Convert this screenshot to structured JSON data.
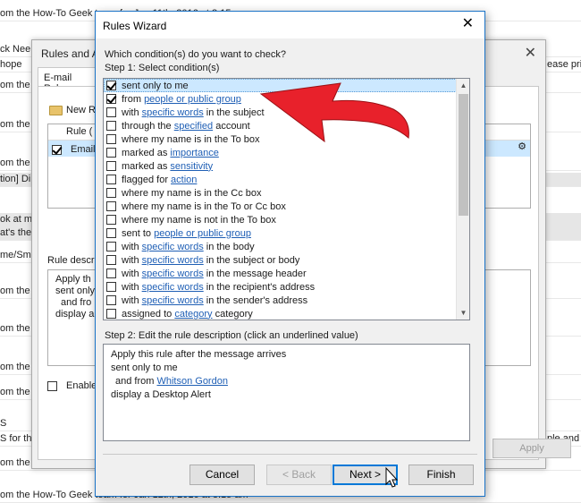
{
  "background_mail": {
    "rows": [
      {
        "text": "om the How-To Geek team for Jan 11th, 2016 at 8:15 am"
      },
      {
        "text": "ck Nee"
      },
      {
        "text": "hope"
      },
      {
        "text": "om the How-To Geek"
      },
      {
        "text": "om the How-To Geek"
      },
      {
        "text": "om the How-To Geek"
      },
      {
        "text": "tion] Di"
      },
      {
        "text": "ok at m"
      },
      {
        "text": "at's the"
      },
      {
        "text": "me/Sma"
      },
      {
        "text": "om the How-To Geek"
      },
      {
        "text": "om the How-To Geek"
      },
      {
        "text": "om the How-To Geek"
      },
      {
        "text": "om the How-To Geek"
      },
      {
        "text": "S"
      },
      {
        "text": "S for th"
      },
      {
        "text": "om the How-To Geek"
      },
      {
        "text": "om the How-To Geek team for Jan 12th, 2016 at 8:15 am"
      }
    ],
    "right_fragments": [
      "ease pri",
      "ple and"
    ]
  },
  "rules_alerts": {
    "title": "Rules and A",
    "tab_label": "E-mail Rule",
    "new_rule": "New R",
    "column_header": "Rule (",
    "rule_name": "Emails",
    "description_label": "Rule descr",
    "description_lines": [
      "Apply th",
      "sent only",
      "and fro",
      "display a"
    ],
    "enable_label": "Enable",
    "apply_label": "Apply"
  },
  "wizard": {
    "title": "Rules Wizard",
    "question": "Which condition(s) do you want to check?",
    "step1_label": "Step 1: Select condition(s)",
    "step2_label": "Step 2: Edit the rule description (click an underlined value)",
    "conditions": [
      {
        "pre": "sent only to me",
        "link": "",
        "post": "",
        "checked": true,
        "selected": true
      },
      {
        "pre": "from ",
        "link": "people or public group",
        "post": "",
        "checked": true,
        "selected": false
      },
      {
        "pre": "with ",
        "link": "specific words",
        "post": " in the subject",
        "checked": false,
        "selected": false
      },
      {
        "pre": "through the ",
        "link": "specified",
        "post": " account",
        "checked": false,
        "selected": false
      },
      {
        "pre": "where my name is in the To box",
        "link": "",
        "post": "",
        "checked": false,
        "selected": false
      },
      {
        "pre": "marked as ",
        "link": "importance",
        "post": "",
        "checked": false,
        "selected": false
      },
      {
        "pre": "marked as ",
        "link": "sensitivity",
        "post": "",
        "checked": false,
        "selected": false
      },
      {
        "pre": "flagged for ",
        "link": "action",
        "post": "",
        "checked": false,
        "selected": false
      },
      {
        "pre": "where my name is in the Cc box",
        "link": "",
        "post": "",
        "checked": false,
        "selected": false
      },
      {
        "pre": "where my name is in the To or Cc box",
        "link": "",
        "post": "",
        "checked": false,
        "selected": false
      },
      {
        "pre": "where my name is not in the To box",
        "link": "",
        "post": "",
        "checked": false,
        "selected": false
      },
      {
        "pre": "sent to ",
        "link": "people or public group",
        "post": "",
        "checked": false,
        "selected": false
      },
      {
        "pre": "with ",
        "link": "specific words",
        "post": " in the body",
        "checked": false,
        "selected": false
      },
      {
        "pre": "with ",
        "link": "specific words",
        "post": " in the subject or body",
        "checked": false,
        "selected": false
      },
      {
        "pre": "with ",
        "link": "specific words",
        "post": " in the message header",
        "checked": false,
        "selected": false
      },
      {
        "pre": "with ",
        "link": "specific words",
        "post": " in the recipient's address",
        "checked": false,
        "selected": false
      },
      {
        "pre": "with ",
        "link": "specific words",
        "post": " in the sender's address",
        "checked": false,
        "selected": false
      },
      {
        "pre": "assigned to ",
        "link": "category",
        "post": " category",
        "checked": false,
        "selected": false
      }
    ],
    "description": {
      "line1": "Apply this rule after the message arrives",
      "line2": "sent only to me",
      "line3_pre": "and from ",
      "line3_link": "Whitson Gordon",
      "line4": "display a Desktop Alert"
    },
    "buttons": {
      "cancel": "Cancel",
      "back": "< Back",
      "next": "Next >",
      "finish": "Finish"
    }
  },
  "colors": {
    "arrow": "#e8212b",
    "link": "#1f5fb5",
    "selection": "#cce8ff",
    "default_button_border": "#0078d7"
  }
}
